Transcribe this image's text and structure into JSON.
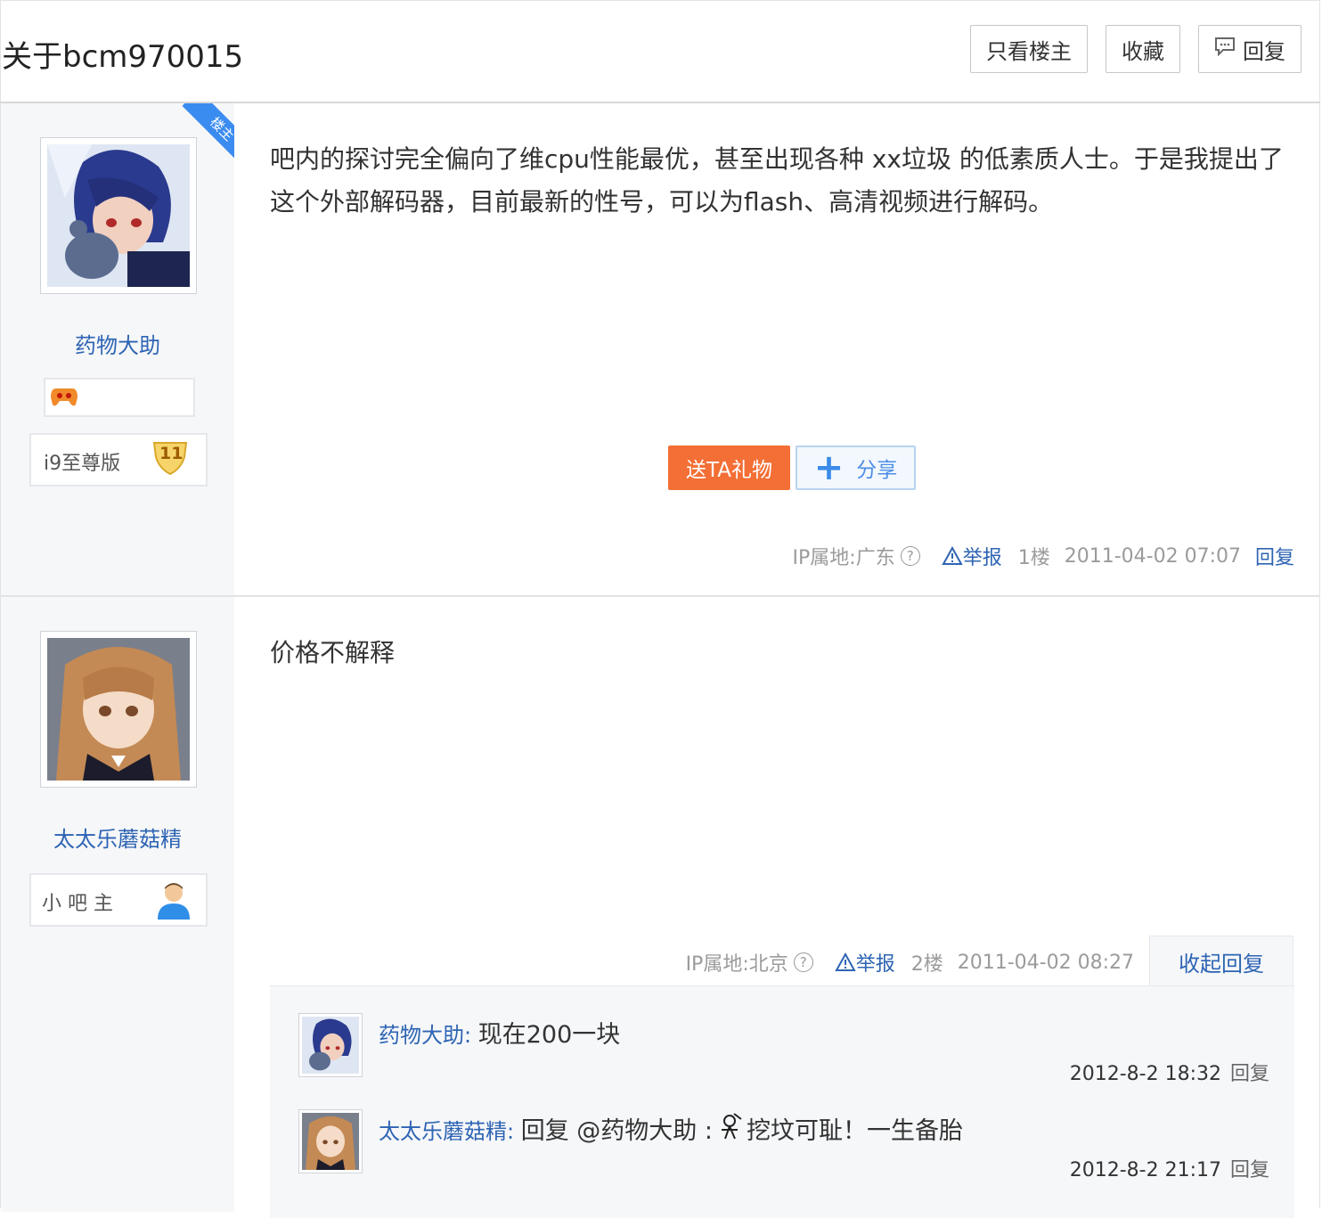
{
  "header": {
    "title": "关于bcm970015",
    "only_lz_label": "只看楼主",
    "favorite_label": "收藏",
    "reply_label": "回复"
  },
  "posts": [
    {
      "author": "药物大助",
      "ribbon": "楼主",
      "level_badge_name": "i9至尊版",
      "level_number": "11",
      "content": "吧内的探讨完全偏向了维cpu性能最优，甚至出现各种 xx垃圾 的低素质人士。于是我提出了这个外部解码器，目前最新的性号，可以为flash、高清视频进行解码。",
      "gift_label": "送TA礼物",
      "share_label": "分享",
      "ip": "IP属地:广东",
      "report_label": "举报",
      "floor": "1楼",
      "time": "2011-04-02 07:07",
      "reply_label": "回复"
    },
    {
      "author": "太太乐蘑菇精",
      "role_badge": "小 吧 主",
      "content": "价格不解释",
      "ip": "IP属地:北京",
      "report_label": "举报",
      "floor": "2楼",
      "time": "2011-04-02 08:27",
      "collapse_label": "收起回复",
      "sub_replies": [
        {
          "author": "药物大助",
          "text": "现在200一块",
          "time": "2012-8-2 18:32",
          "reply_label": "回复"
        },
        {
          "author": "太太乐蘑菇精",
          "text_before": "回复 @药物大助 :",
          "text_after": "挖坟可耻！一生备胎",
          "time": "2012-8-2 21:17",
          "reply_label": "回复"
        }
      ]
    }
  ],
  "colors": {
    "link": "#2d64b3",
    "gift": "#f36f35",
    "share": "#4b8ee5",
    "ribbon": "#3b8cf0"
  }
}
